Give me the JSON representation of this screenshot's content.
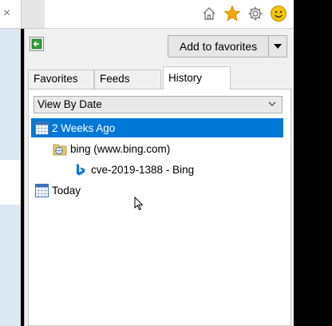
{
  "browser": {
    "close_glyph": "×"
  },
  "toolbar": {
    "icons": [
      "home-icon",
      "favorites-star-icon",
      "settings-gear-icon",
      "feedback-smiley-icon"
    ],
    "star_color": "#f2a900",
    "smiley_color": "#f5c400"
  },
  "favorites_center": {
    "add_to_favorites_label": "Add to favorites",
    "tabs": [
      {
        "label": "Favorites",
        "active": false
      },
      {
        "label": "Feeds",
        "active": false
      },
      {
        "label": "History",
        "active": true
      }
    ],
    "view_by": "View By Date",
    "selection_color": "#0078d7",
    "history": [
      {
        "label": "2 Weeks Ago",
        "type": "date-group",
        "selected": true
      },
      {
        "label": "bing (www.bing.com)",
        "type": "site",
        "selected": false
      },
      {
        "label": "cve-2019-1388 - Bing",
        "type": "page",
        "selected": false
      },
      {
        "label": "Today",
        "type": "date-group",
        "selected": false
      }
    ]
  }
}
